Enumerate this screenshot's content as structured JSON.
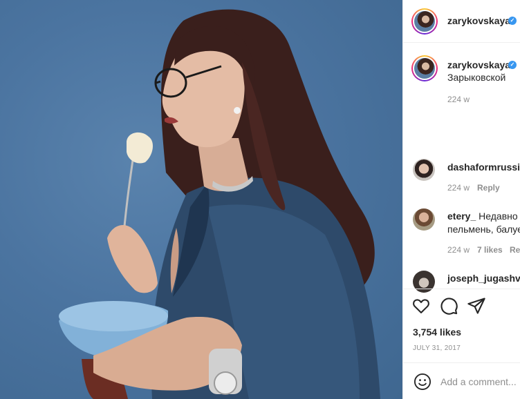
{
  "post": {
    "username": "zarykovskaya",
    "verified": true,
    "caption": "Зарыковской",
    "caption_time": "224 w"
  },
  "comments": [
    {
      "username": "dashaformrussia",
      "text": "",
      "line2": "",
      "time": "224 w",
      "likes": "",
      "reply": "Reply"
    },
    {
      "username": "etery_",
      "text": "Недавно в",
      "line2": "пельмень, балуе",
      "time": "224 w",
      "likes": "7 likes",
      "reply": "Rep"
    },
    {
      "username": "joseph_jugashvili",
      "text": "",
      "line2": "",
      "time": "",
      "likes": "",
      "reply": ""
    }
  ],
  "actions": {
    "like_icon": "heart-icon",
    "comment_icon": "comment-icon",
    "share_icon": "share-icon",
    "likes_count": "3,754 likes",
    "date": "JULY 31, 2017"
  },
  "add_comment": {
    "emoji_icon": "emoji-icon",
    "placeholder": "Add a comment..."
  },
  "colors": {
    "background_blue": "#4b74a0",
    "verified_blue": "#3897f0",
    "muted_text": "#8e8e8e"
  }
}
